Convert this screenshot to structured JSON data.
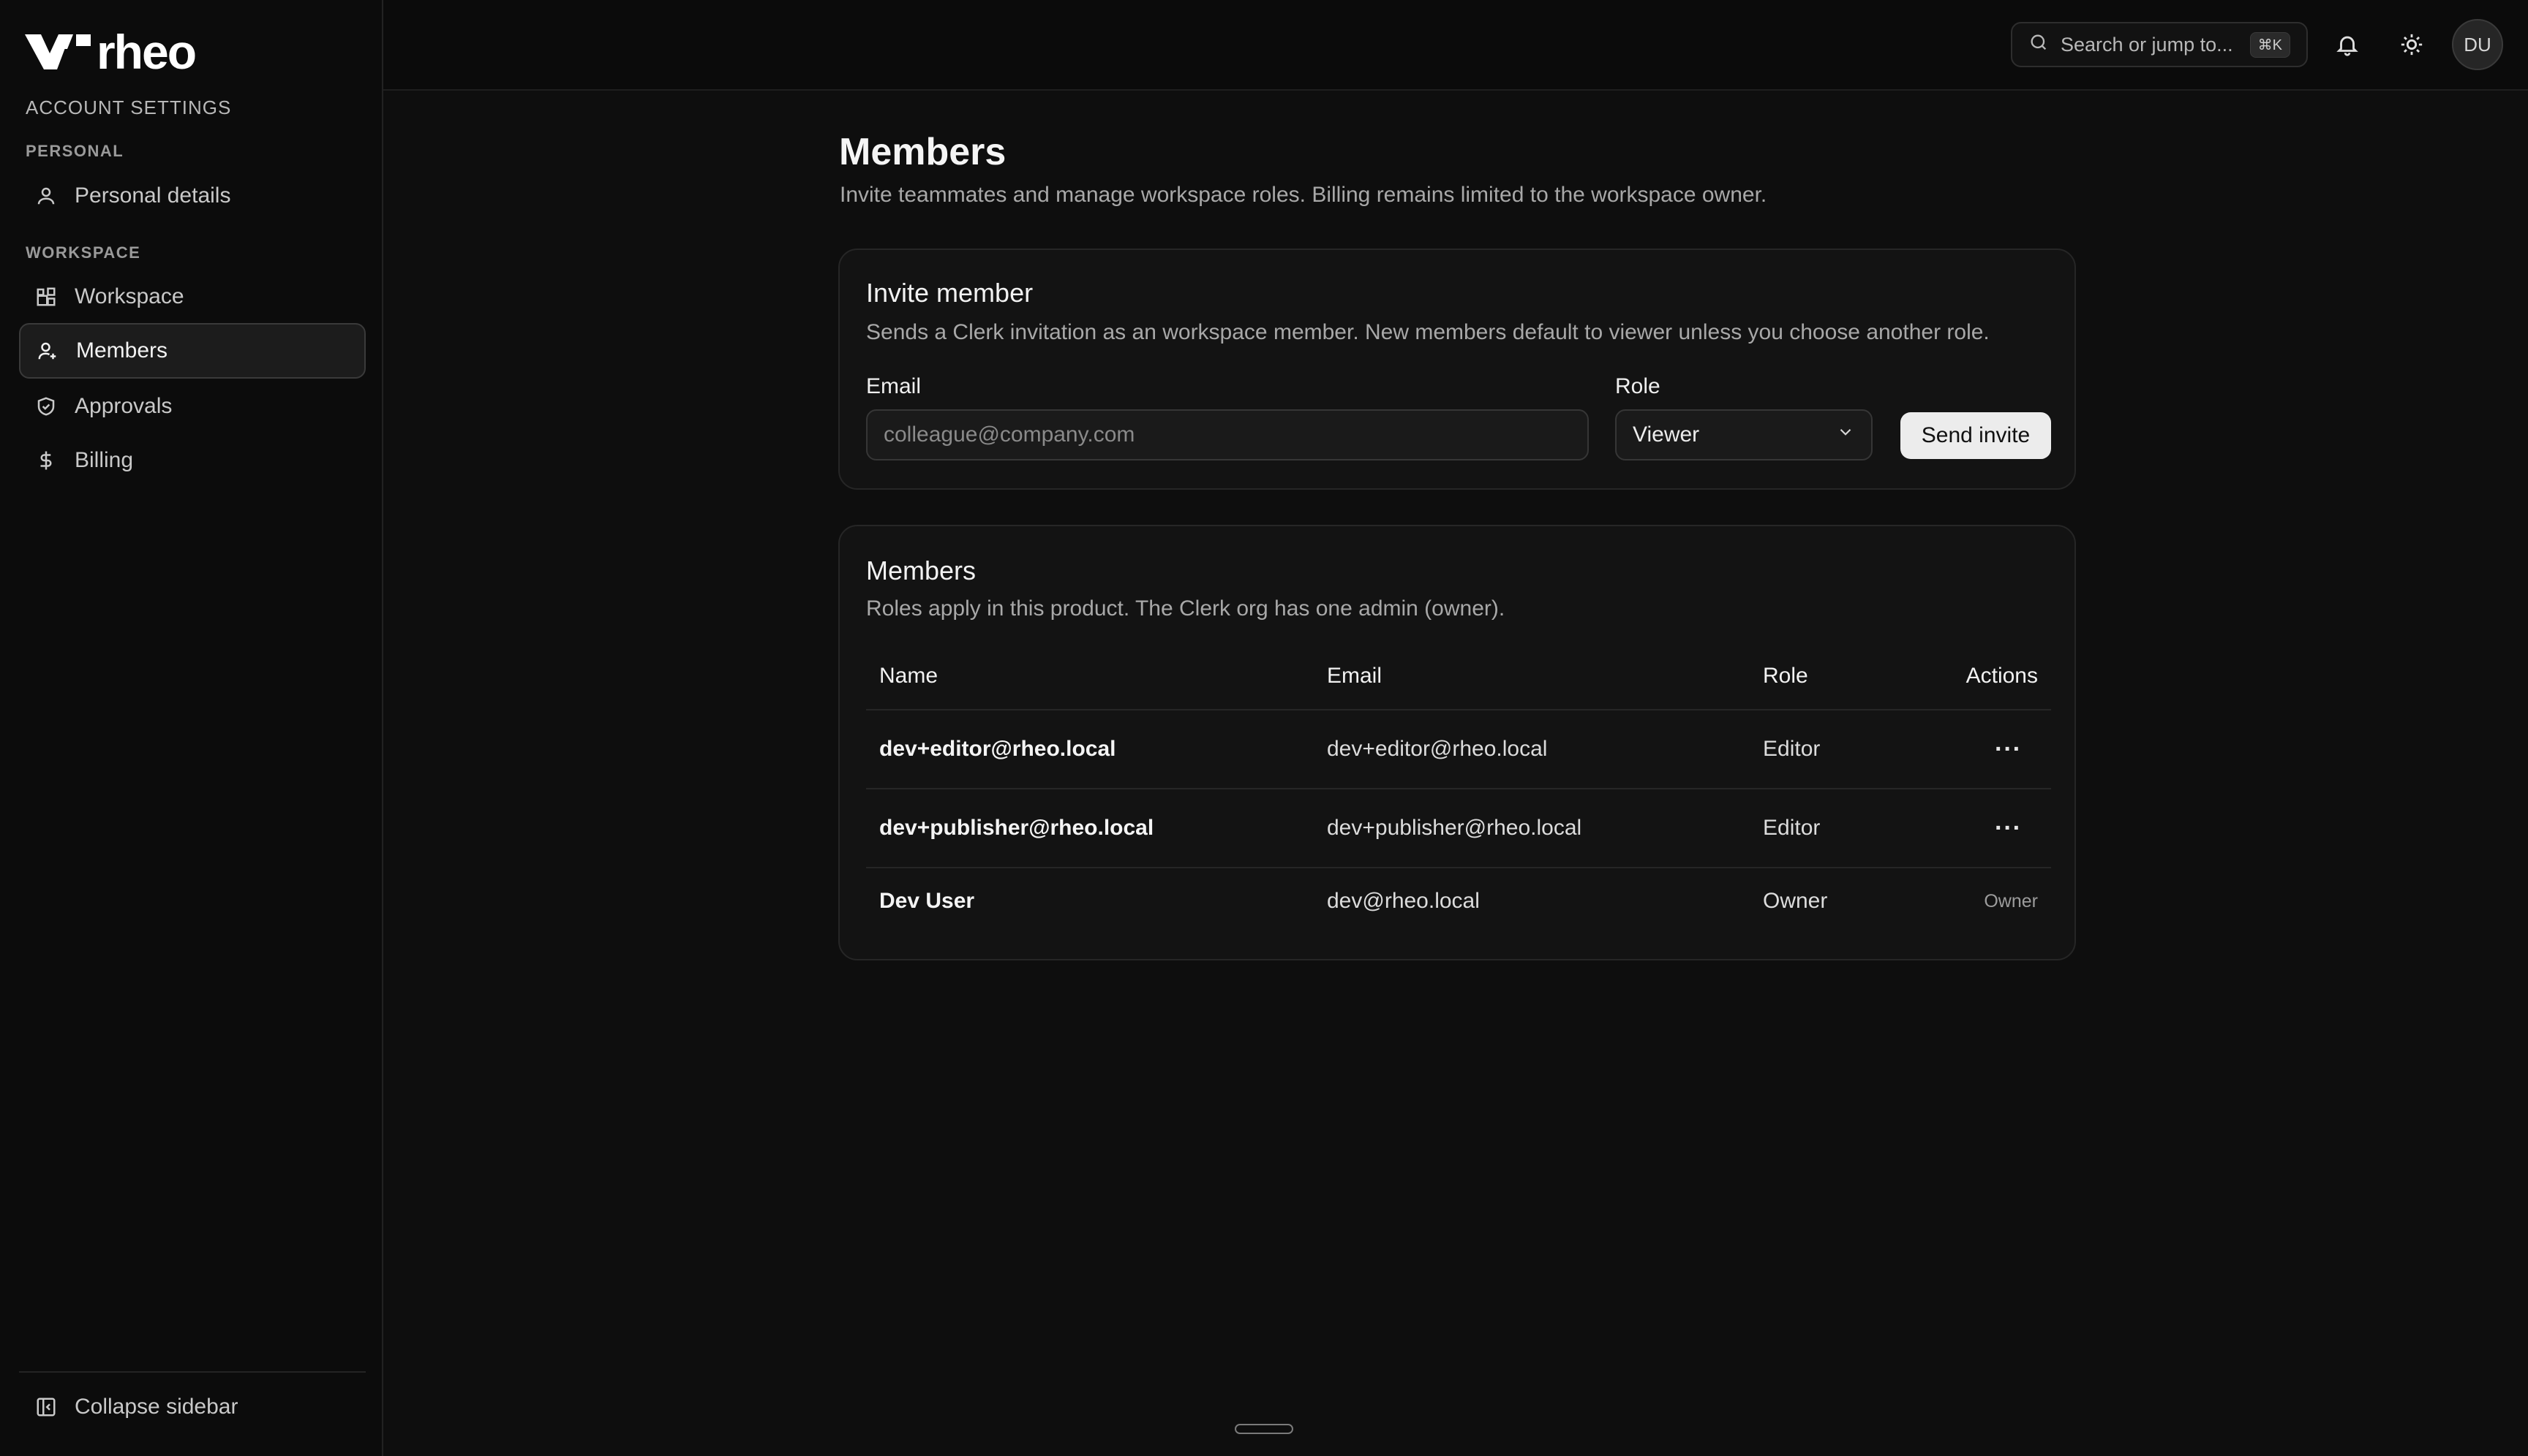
{
  "app": {
    "name": "rheo"
  },
  "sidebar": {
    "section_label": "ACCOUNT SETTINGS",
    "groups": [
      {
        "label": "PERSONAL"
      },
      {
        "label": "WORKSPACE"
      }
    ],
    "items": [
      {
        "label": "Personal details",
        "icon": "user-icon"
      },
      {
        "label": "Workspace",
        "icon": "grid-icon"
      },
      {
        "label": "Members",
        "icon": "user-plus-icon",
        "active": true
      },
      {
        "label": "Approvals",
        "icon": "shield-check-icon"
      },
      {
        "label": "Billing",
        "icon": "dollar-icon"
      }
    ],
    "collapse_label": "Collapse sidebar"
  },
  "topbar": {
    "search_placeholder": "Search or jump to...",
    "search_shortcut": "⌘K",
    "avatar_initials": "DU"
  },
  "page": {
    "title": "Members",
    "subtitle": "Invite teammates and manage workspace roles. Billing remains limited to the workspace owner."
  },
  "invite": {
    "title": "Invite member",
    "subtitle": "Sends a Clerk invitation as an workspace member. New members default to viewer unless you choose another role.",
    "email_label": "Email",
    "email_placeholder": "colleague@company.com",
    "role_label": "Role",
    "role_value": "Viewer",
    "send_label": "Send invite"
  },
  "members": {
    "title": "Members",
    "subtitle": "Roles apply in this product. The Clerk org has one admin (owner).",
    "columns": {
      "name": "Name",
      "email": "Email",
      "role": "Role",
      "actions": "Actions"
    },
    "rows": [
      {
        "name": "dev+editor@rheo.local",
        "email": "dev+editor@rheo.local",
        "role": "Editor",
        "action": "···"
      },
      {
        "name": "dev+publisher@rheo.local",
        "email": "dev+publisher@rheo.local",
        "role": "Editor",
        "action": "···"
      },
      {
        "name": "Dev User",
        "email": "dev@rheo.local",
        "role": "Owner",
        "action": "Owner"
      }
    ]
  }
}
